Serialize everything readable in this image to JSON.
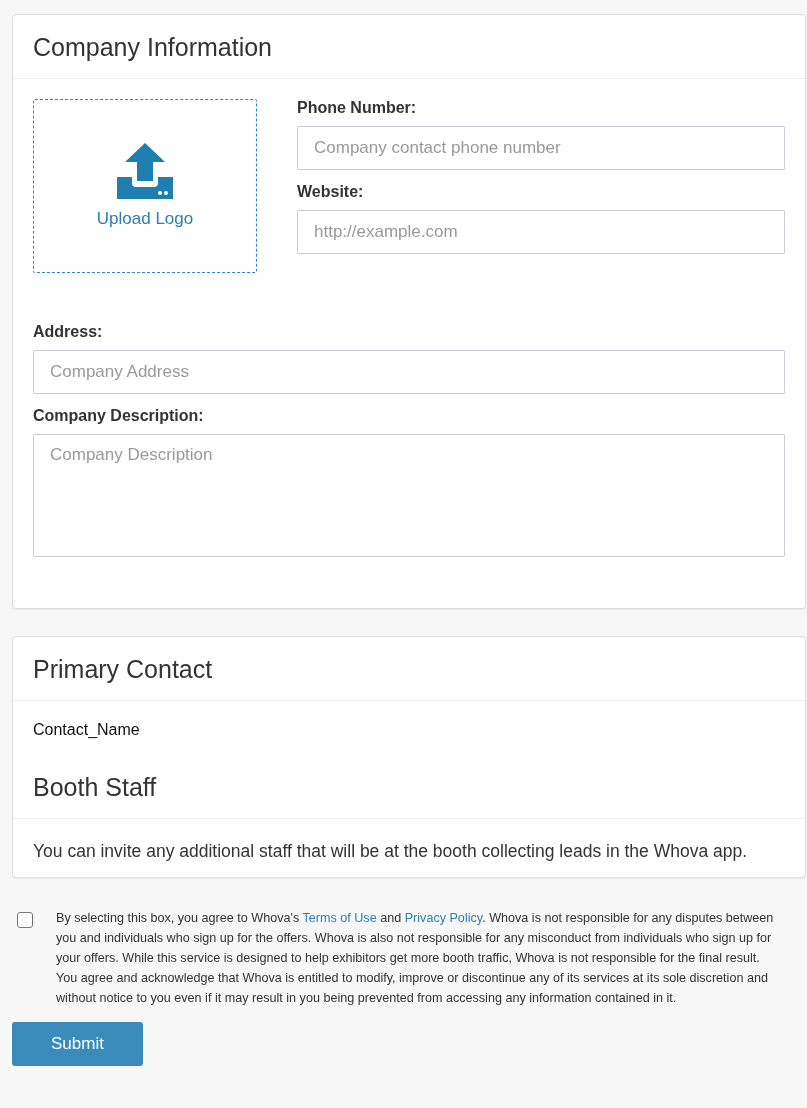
{
  "company_information": {
    "title": "Company Information",
    "upload": {
      "label": "Upload Logo"
    },
    "fields": [
      {
        "kind": "input",
        "label": "Phone Number:",
        "placeholder": "Company contact phone number"
      },
      {
        "kind": "input",
        "label": "Website:",
        "placeholder": "http://example.com"
      },
      {
        "kind": "input",
        "label": "Address:",
        "placeholder": "Company Address"
      },
      {
        "kind": "textarea",
        "label": "Company Description:",
        "placeholder": "Company Description"
      }
    ]
  },
  "primary_contact": {
    "title": "Primary Contact",
    "name": "Contact_Name"
  },
  "booth_staff": {
    "title": "Booth Staff",
    "description": "You can invite any additional staff that will be at the booth collecting leads in the Whova app."
  },
  "agreement": {
    "checked": false,
    "parts": [
      {
        "kind": "text",
        "text": "By selecting this box, you agree to Whova's "
      },
      {
        "kind": "link",
        "text": "Terms of Use"
      },
      {
        "kind": "text",
        "text": " and "
      },
      {
        "kind": "link",
        "text": "Privacy Policy"
      },
      {
        "kind": "text",
        "text": ". Whova is not responsible for any disputes between you and individuals who sign up for the offers. Whova is also not responsible for any misconduct from individuals who sign up for your offers. While this service is designed to help exhibitors get more booth traffic, Whova is not responsible for the final result. You agree and acknowledge that Whova is entitled to modify, improve or discontinue any of its services at its sole discretion and without notice to you even if it may result in you being prevented from accessing any information contained in it."
      }
    ]
  },
  "submit": {
    "label": "Submit"
  }
}
